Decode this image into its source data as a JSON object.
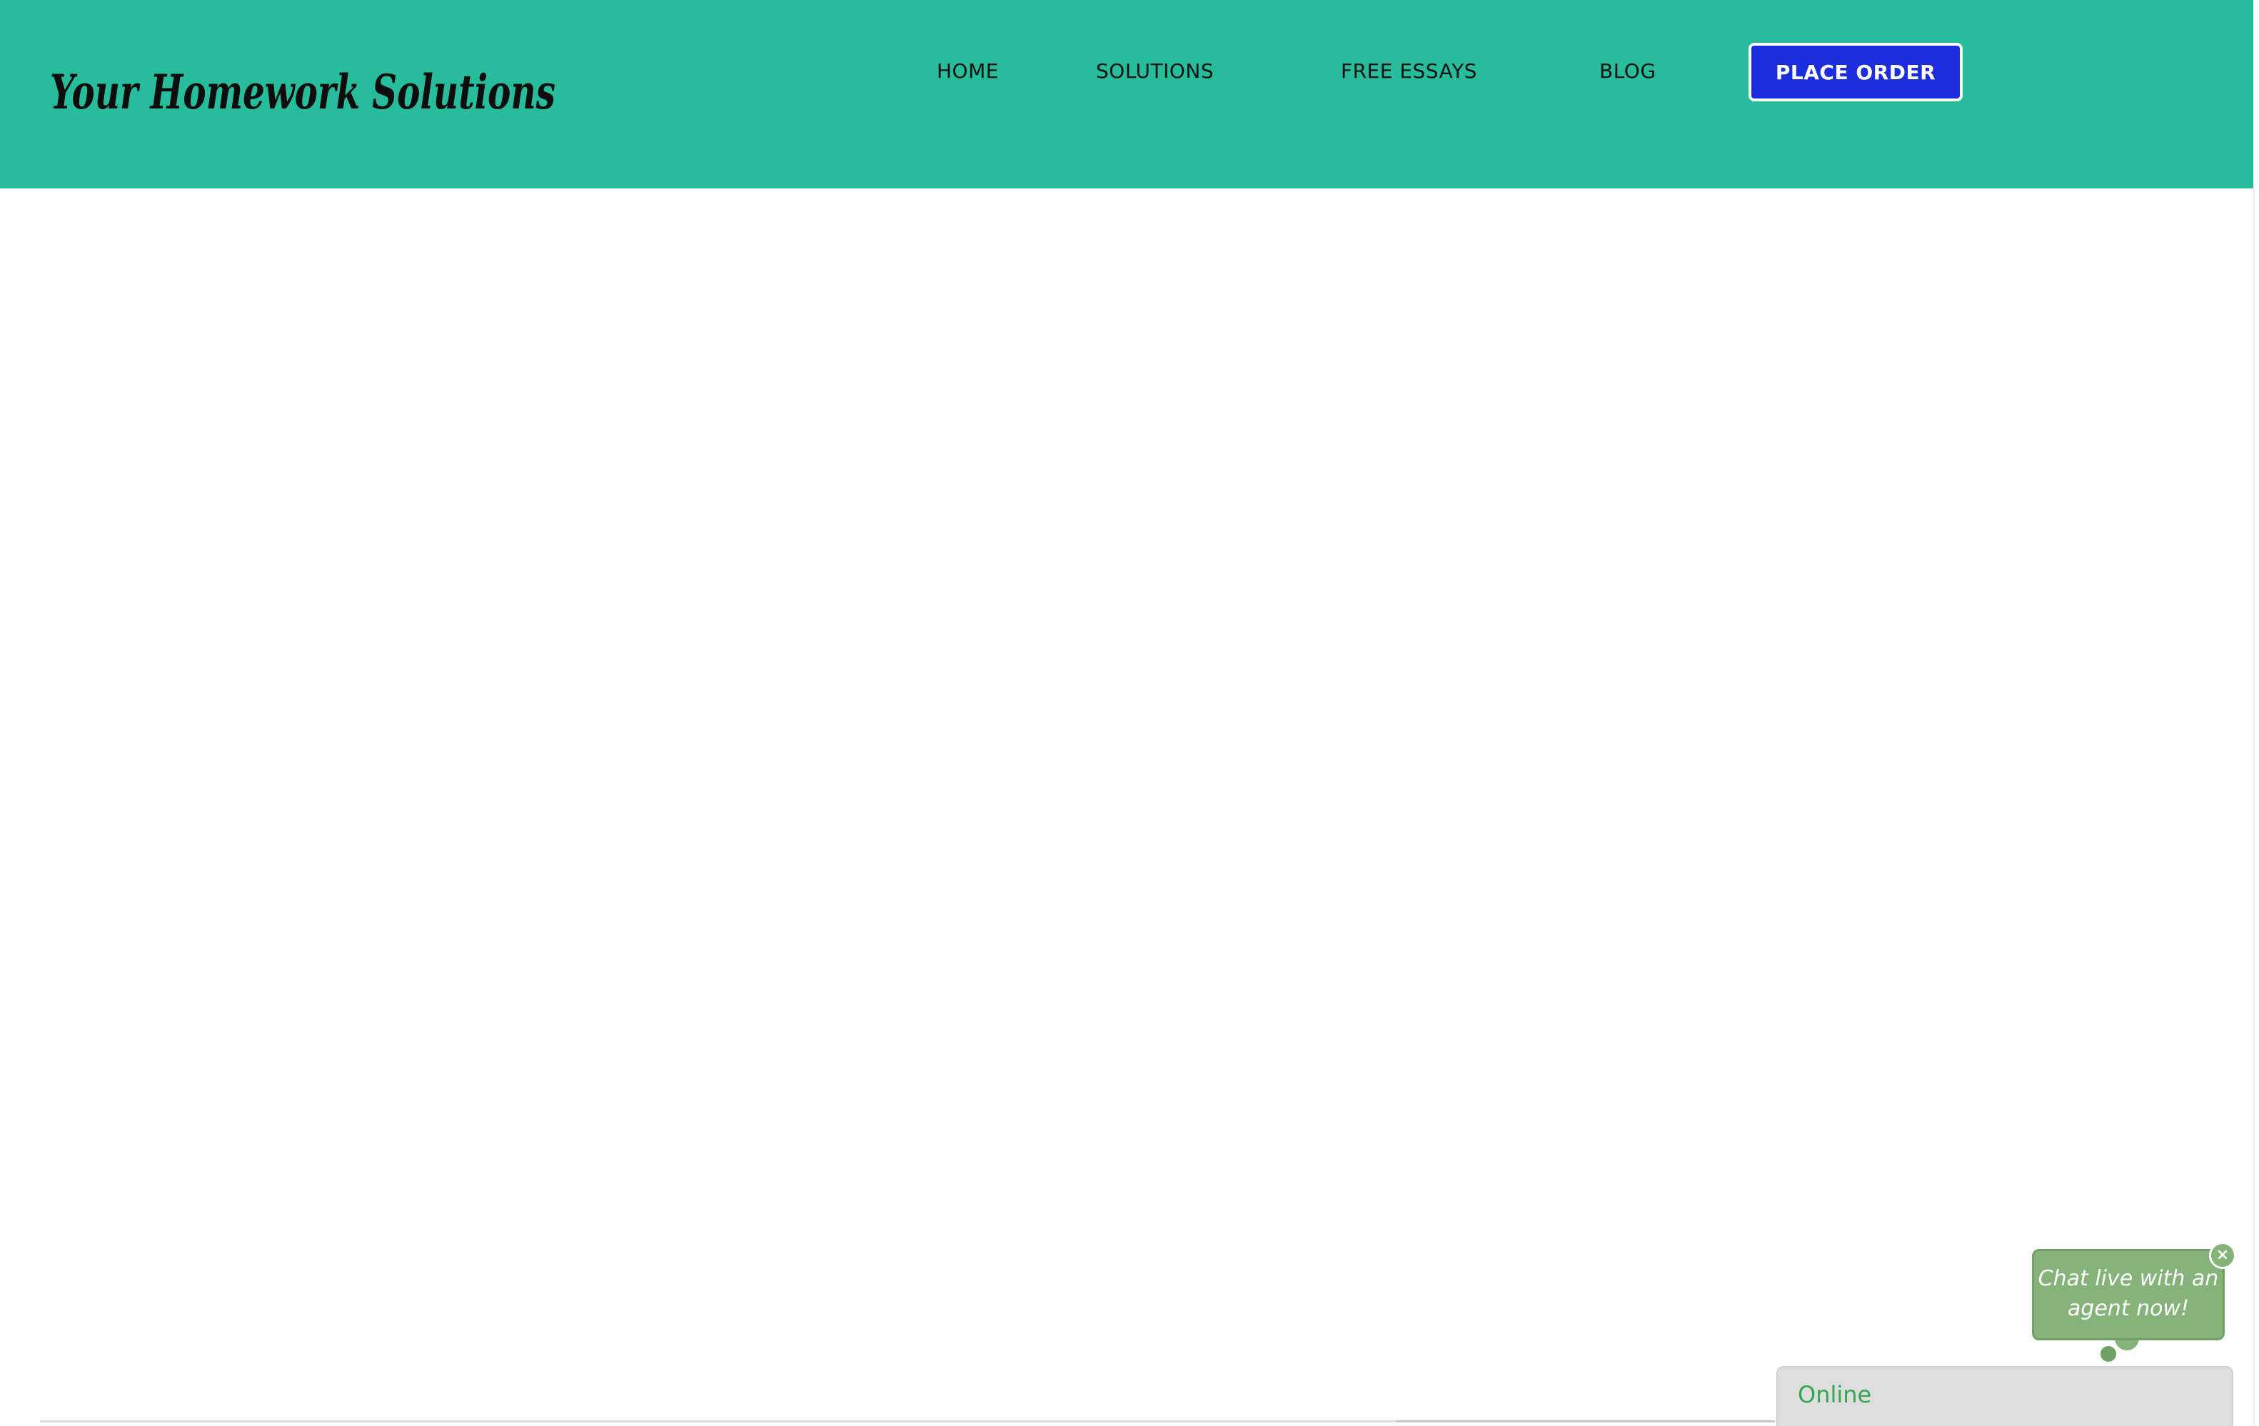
{
  "brand": {
    "logo_text": "Your Homework Solutions",
    "header_color": "#27bc9b"
  },
  "nav": {
    "items": [
      {
        "label": "HOME"
      },
      {
        "label": "SOLUTIONS"
      },
      {
        "label": "FREE ESSAYS"
      },
      {
        "label": "BLOG"
      }
    ],
    "cta_label": "PLACE ORDER",
    "cta_color": "#1b2ddc"
  },
  "chat": {
    "bubble_text": "Chat live with an agent now!",
    "close_glyph": "×",
    "status_text": "Online",
    "bubble_color": "#86b37a",
    "status_color": "#2fa84f",
    "close_icon": "close-icon"
  }
}
